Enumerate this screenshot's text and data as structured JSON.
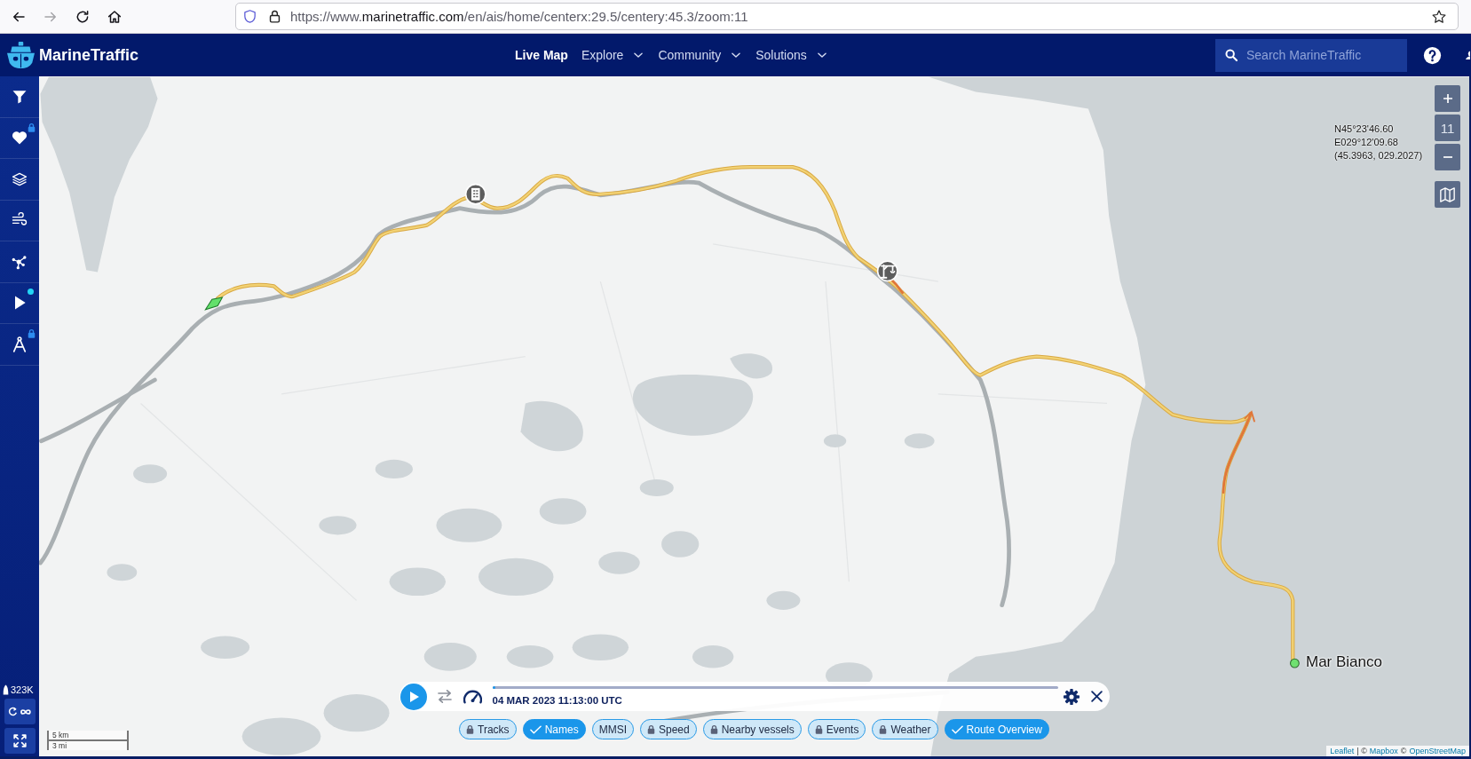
{
  "browser": {
    "back_enabled": true,
    "forward_enabled": false,
    "url": {
      "prefix": "https://www.",
      "domain": "marinetraffic.com",
      "path": "/en/ais/home/centerx:29.5/centery:45.3/zoom:11"
    },
    "bookmarked": false
  },
  "header": {
    "logo": "MarineTraffic",
    "nav": [
      {
        "label": "Live Map",
        "selected": true,
        "dropdown": false
      },
      {
        "label": "Explore",
        "selected": false,
        "dropdown": true
      },
      {
        "label": "Community",
        "selected": false,
        "dropdown": true
      },
      {
        "label": "Solutions",
        "selected": false,
        "dropdown": true
      }
    ],
    "search": {
      "placeholder": "Search MarineTraffic"
    }
  },
  "sidebar": {
    "items": [
      {
        "locked": false,
        "notification": false
      },
      {
        "locked": true,
        "notification": false
      },
      {
        "locked": false,
        "notification": false
      },
      {
        "locked": false,
        "notification": false
      },
      {
        "locked": false,
        "notification": false
      },
      {
        "locked": false,
        "notification": true
      },
      {
        "locked": true,
        "notification": false
      }
    ],
    "vessel_count": "323K"
  },
  "map": {
    "zoom_level": "11",
    "coordinates": [
      "N45°23'46.60",
      "E029°12'09.68",
      "(45.3963, 029.2027)"
    ],
    "vessel_label": "Mar Bianco",
    "scale": [
      "5 km",
      "3 mi"
    ],
    "attribution": [
      {
        "kind": "link",
        "text": "Leaflet"
      },
      {
        "kind": "text",
        "text": "| ©"
      },
      {
        "kind": "link",
        "text": "Mapbox"
      },
      {
        "kind": "text",
        "text": "©"
      },
      {
        "kind": "link",
        "text": "OpenStreetMap"
      }
    ]
  },
  "playback": {
    "playing": false,
    "level": 0.006,
    "timestamp": "04 MAR 2023 11:13:00 UTC",
    "chips": [
      {
        "label": "Tracks",
        "selected": false,
        "locked": true
      },
      {
        "label": "Names",
        "selected": true,
        "locked": false
      },
      {
        "label": "MMSI",
        "selected": false,
        "locked": false
      },
      {
        "label": "Speed",
        "selected": false,
        "locked": true
      },
      {
        "label": "Nearby vessels",
        "selected": false,
        "locked": true
      },
      {
        "label": "Events",
        "selected": false,
        "locked": true
      },
      {
        "label": "Weather",
        "selected": false,
        "locked": true
      },
      {
        "label": "Route Overview",
        "selected": true,
        "locked": false
      }
    ]
  }
}
